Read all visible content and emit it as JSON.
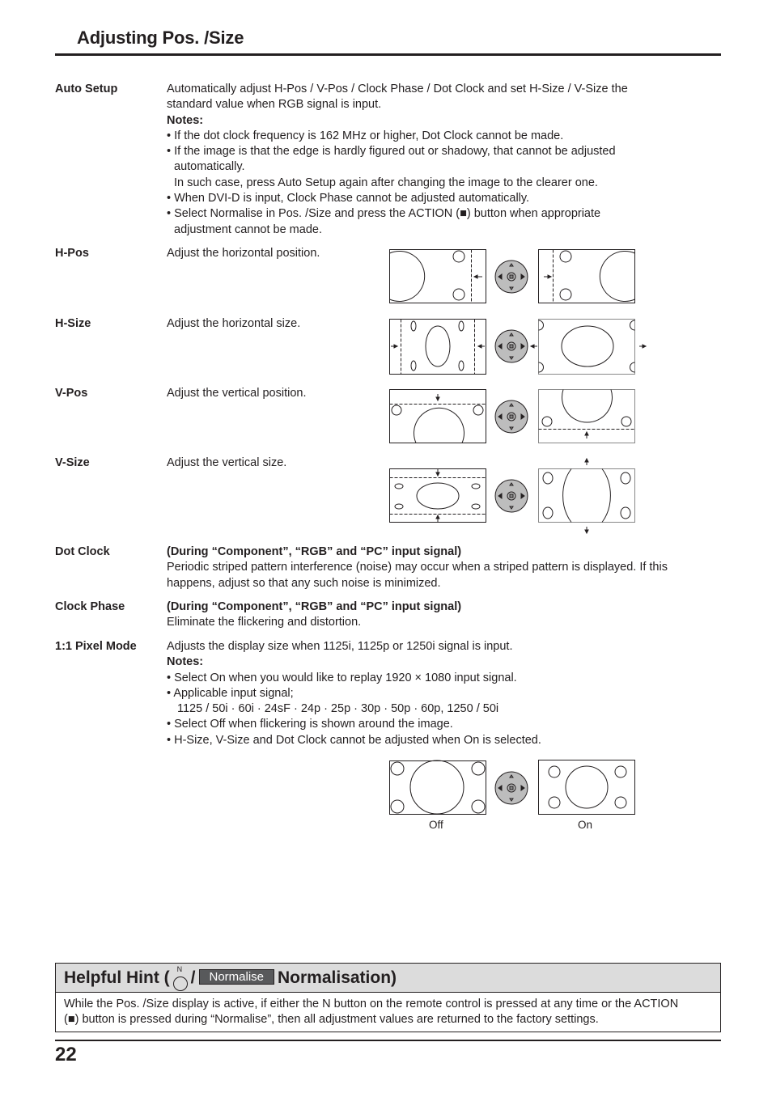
{
  "page": {
    "title": "Adjusting Pos. /Size",
    "page_number": "22"
  },
  "items": {
    "auto_setup": {
      "term": "Auto Setup",
      "desc": "Automatically adjust H-Pos / V-Pos / Clock Phase / Dot Clock and set H-Size / V-Size the",
      "desc2": "standard value when RGB signal is input.",
      "notes_label": "Notes:",
      "notes": [
        "If the dot clock frequency is 162 MHz or higher, Dot Clock cannot be made.",
        "If the image is that the edge is hardly figured out or shadowy, that cannot be adjusted",
        "automatically.",
        "In such case, press Auto Setup again after changing the image to the clearer one.",
        "When DVI-D is input, Clock Phase cannot be adjusted automatically.",
        "Select Normalise in Pos. /Size and press the ACTION (■) button when appropriate",
        "adjustment cannot be made."
      ]
    },
    "h_pos": {
      "term": "H-Pos",
      "desc": "Adjust the horizontal position."
    },
    "h_size": {
      "term": "H-Size",
      "desc": "Adjust the horizontal size."
    },
    "v_pos": {
      "term": "V-Pos",
      "desc": "Adjust the vertical position."
    },
    "v_size": {
      "term": "V-Size",
      "desc": "Adjust the vertical size."
    },
    "dot_clock": {
      "term": "Dot Clock",
      "heading": "(During “Component”, “RGB” and “PC” input signal)",
      "desc": "Periodic striped pattern interference (noise) may occur when a striped pattern is displayed. If this",
      "desc2": "happens, adjust so that any such noise is minimized."
    },
    "clock_phase": {
      "term": "Clock Phase",
      "heading": "(During “Component”, “RGB” and “PC” input signal)",
      "desc": "Eliminate the flickering and distortion."
    },
    "pixel_mode": {
      "term": "1:1 Pixel Mode",
      "desc": "Adjusts the display size when 1125i, 1125p or 1250i signal is input.",
      "notes_label": "Notes:",
      "notes": [
        "Select On when you would like to replay 1920 × 1080 input signal.",
        "Applicable input signal;",
        "1125 / 50i · 60i · 24sF · 24p · 25p · 30p · 50p · 60p, 1250 / 50i",
        "Select Off when flickering is shown around the image.",
        "H-Size, V-Size and Dot Clock cannot be adjusted when On is selected."
      ],
      "caption_off": "Off",
      "caption_on": "On"
    }
  },
  "hint": {
    "title_prefix": "Helpful Hint (",
    "n_label": "N",
    "slash": "/",
    "normalise_label": "Normalise",
    "title_suffix": "Normalisation)",
    "body1": "While the Pos. /Size display is active, if either the N button on the remote control is pressed at any time or the ACTION",
    "body2": "(■) button is pressed during “Normalise”, then all adjustment values are returned to the factory settings."
  }
}
